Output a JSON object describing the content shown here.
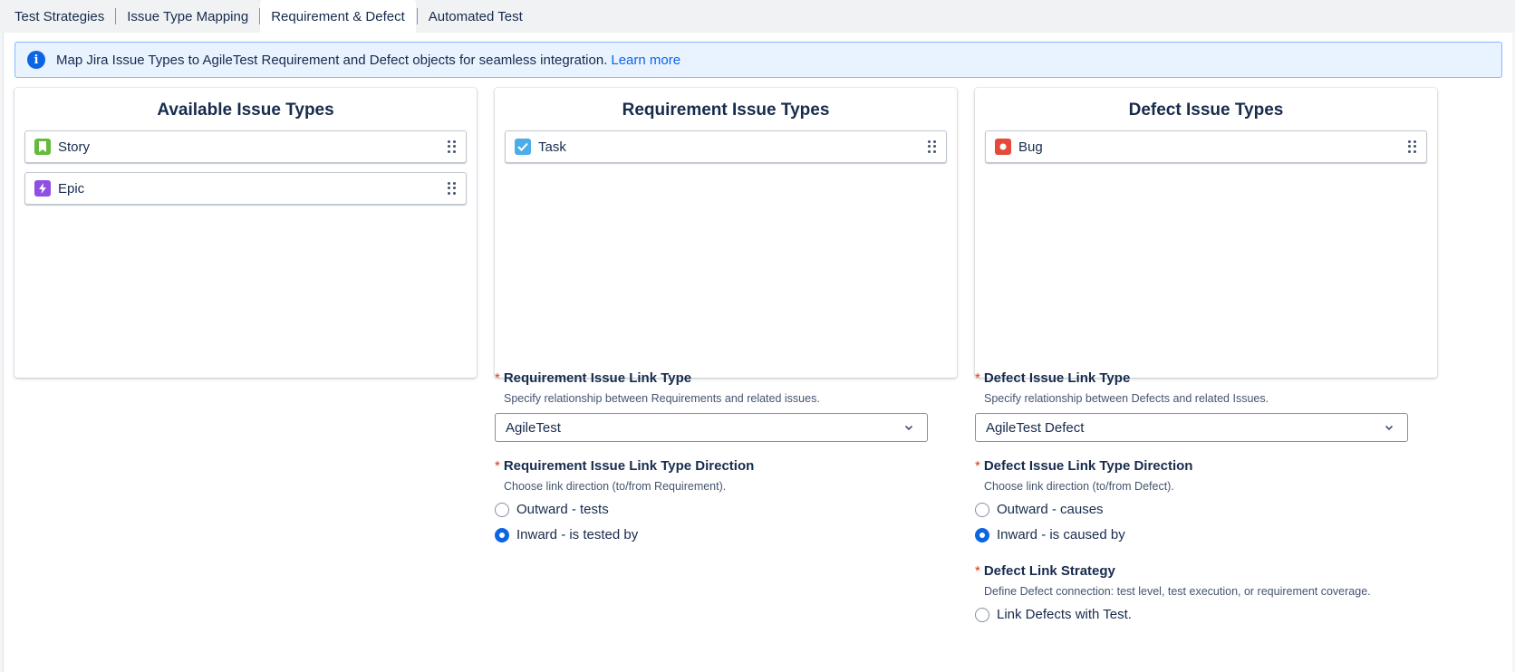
{
  "tabs": [
    {
      "label": "Test Strategies"
    },
    {
      "label": "Issue Type Mapping"
    },
    {
      "label": "Requirement & Defect"
    },
    {
      "label": "Automated Test"
    }
  ],
  "banner": {
    "text": "Map Jira Issue Types to AgileTest Requirement and Defect objects for seamless integration.",
    "link": "Learn more"
  },
  "panels": {
    "available": {
      "title": "Available Issue Types",
      "items": [
        {
          "label": "Story",
          "icon": "story-icon",
          "color": "#63ba3c"
        },
        {
          "label": "Epic",
          "icon": "epic-icon",
          "color": "#904ee2"
        }
      ]
    },
    "requirement": {
      "title": "Requirement Issue Types",
      "items": [
        {
          "label": "Task",
          "icon": "task-icon",
          "color": "#4bade8"
        }
      ]
    },
    "defect": {
      "title": "Defect Issue Types",
      "items": [
        {
          "label": "Bug",
          "icon": "bug-icon",
          "color": "#e5493a"
        }
      ]
    }
  },
  "requirement_settings": {
    "link_type": {
      "label": "Requirement Issue Link Type",
      "description": "Specify relationship between Requirements and related issues.",
      "value": "AgileTest"
    },
    "direction": {
      "label": "Requirement Issue Link Type Direction",
      "description": "Choose link direction (to/from Requirement).",
      "options": [
        {
          "label": "Outward - tests",
          "checked": false
        },
        {
          "label": "Inward - is tested by",
          "checked": true
        }
      ]
    }
  },
  "defect_settings": {
    "link_type": {
      "label": "Defect Issue Link Type",
      "description": "Specify relationship between Defects and related Issues.",
      "value": "AgileTest Defect"
    },
    "direction": {
      "label": "Defect Issue Link Type Direction",
      "description": "Choose link direction (to/from Defect).",
      "options": [
        {
          "label": "Outward - causes",
          "checked": false
        },
        {
          "label": "Inward - is caused by",
          "checked": true
        }
      ]
    },
    "strategy": {
      "label": "Defect Link Strategy",
      "description": "Define Defect connection: test level, test execution, or requirement coverage.",
      "options": [
        {
          "label": "Link Defects with Test.",
          "checked": false
        }
      ]
    }
  },
  "required_marker": "*"
}
